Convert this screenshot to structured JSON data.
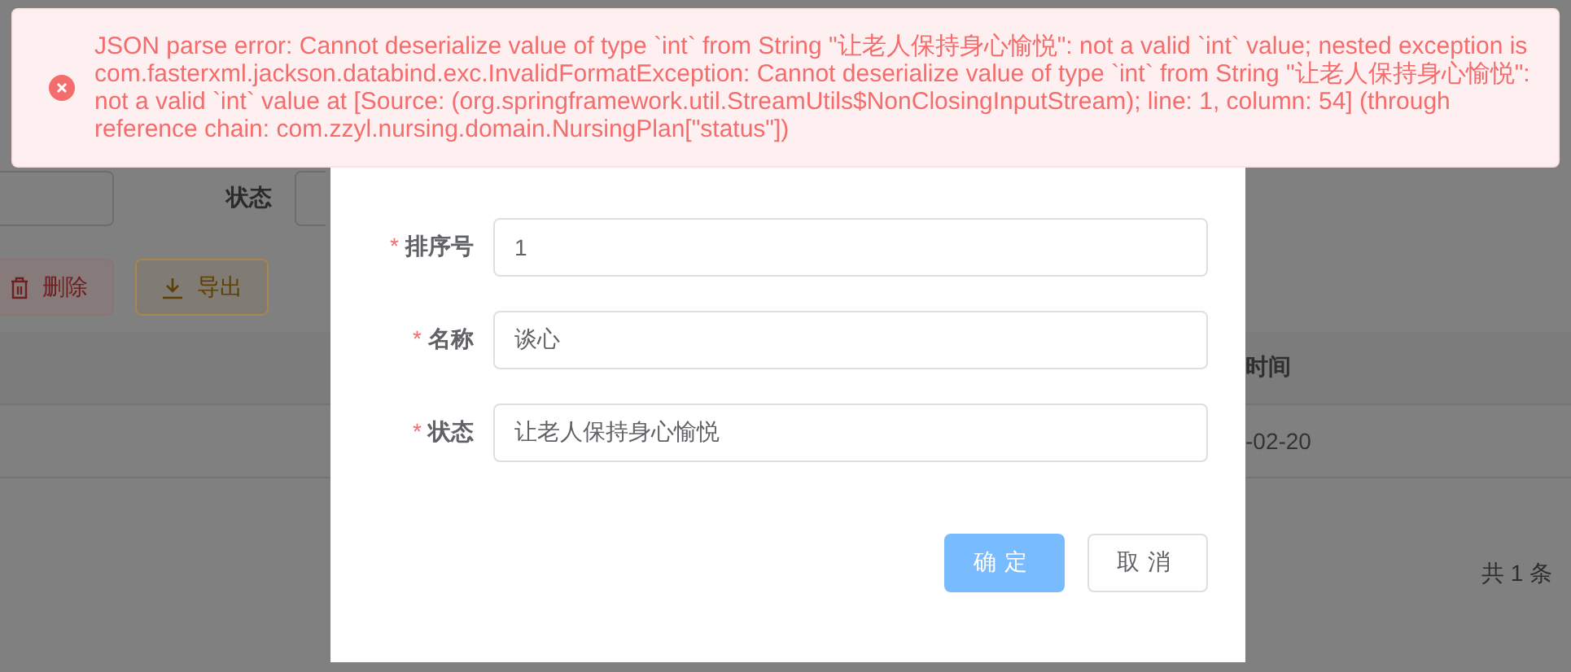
{
  "message": {
    "text": "JSON parse error: Cannot deserialize value of type `int` from String \"让老人保持身心愉悦\": not a valid `int` value; nested exception is com.fasterxml.jackson.databind.exc.InvalidFormatException: Cannot deserialize value of type `int` from String \"让老人保持身心愉悦\": not a valid `int` value at [Source: (org.springframework.util.StreamUtils$NonClosingInputStream); line: 1, column: 54] (through reference chain: com.zzyl.nursing.domain.NursingPlan[\"status\"])"
  },
  "background": {
    "filter_label": "状态",
    "buttons": [
      {
        "label": "删除",
        "kind": "danger"
      },
      {
        "label": "导出",
        "kind": "warning"
      }
    ],
    "table": {
      "header": "时间",
      "cell": "-02-20"
    },
    "total": "共 1 条"
  },
  "dialog": {
    "fields": [
      {
        "required_mark": "*",
        "label": "排序号",
        "value": "1"
      },
      {
        "required_mark": "*",
        "label": "名称",
        "value": "谈心"
      },
      {
        "required_mark": "*",
        "label": "状态",
        "value": "让老人保持身心愉悦"
      }
    ],
    "buttons": [
      {
        "label": "确定",
        "kind": "primary"
      },
      {
        "label": "取消",
        "kind": "default"
      }
    ]
  }
}
